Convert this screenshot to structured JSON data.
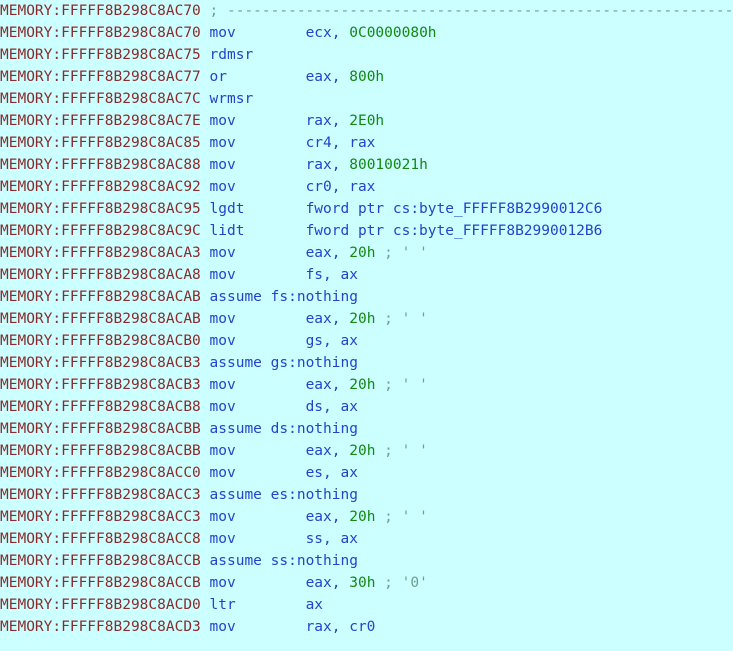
{
  "view": {
    "name": "IDA Pro disassembly listing",
    "segment": "MEMORY",
    "background_color": "#ccffff",
    "address_color": "#8b2b2b",
    "mnemonic_color": "#2244cc",
    "operand_color": "#2244cc",
    "number_color": "#118811",
    "comment_color": "#6f9f8f"
  },
  "lines": [
    {
      "address": "MEMORY:FFFFF8B298C8AC70",
      "kind": "comment",
      "comment": "; ---------------------------------------------------------------------------"
    },
    {
      "address": "MEMORY:FFFFF8B298C8AC70",
      "kind": "insn",
      "mnemonic": "mov",
      "operand_prefix": "ecx, ",
      "operand_number": "0C0000080h",
      "operand_suffix": "",
      "comment": ""
    },
    {
      "address": "MEMORY:FFFFF8B298C8AC75",
      "kind": "insn",
      "mnemonic": "rdmsr",
      "operand_prefix": "",
      "operand_number": "",
      "operand_suffix": "",
      "comment": ""
    },
    {
      "address": "MEMORY:FFFFF8B298C8AC77",
      "kind": "insn",
      "mnemonic": "or",
      "operand_prefix": "eax, ",
      "operand_number": "800h",
      "operand_suffix": "",
      "comment": ""
    },
    {
      "address": "MEMORY:FFFFF8B298C8AC7C",
      "kind": "insn",
      "mnemonic": "wrmsr",
      "operand_prefix": "",
      "operand_number": "",
      "operand_suffix": "",
      "comment": ""
    },
    {
      "address": "MEMORY:FFFFF8B298C8AC7E",
      "kind": "insn",
      "mnemonic": "mov",
      "operand_prefix": "rax, ",
      "operand_number": "2E0h",
      "operand_suffix": "",
      "comment": ""
    },
    {
      "address": "MEMORY:FFFFF8B298C8AC85",
      "kind": "insn",
      "mnemonic": "mov",
      "operand_prefix": "cr4, rax",
      "operand_number": "",
      "operand_suffix": "",
      "comment": ""
    },
    {
      "address": "MEMORY:FFFFF8B298C8AC88",
      "kind": "insn",
      "mnemonic": "mov",
      "operand_prefix": "rax, ",
      "operand_number": "80010021h",
      "operand_suffix": "",
      "comment": ""
    },
    {
      "address": "MEMORY:FFFFF8B298C8AC92",
      "kind": "insn",
      "mnemonic": "mov",
      "operand_prefix": "cr0, rax",
      "operand_number": "",
      "operand_suffix": "",
      "comment": ""
    },
    {
      "address": "MEMORY:FFFFF8B298C8AC95",
      "kind": "insn",
      "mnemonic": "lgdt",
      "operand_prefix": "fword ptr cs:byte_FFFFF8B2990012C6",
      "operand_number": "",
      "operand_suffix": "",
      "comment": ""
    },
    {
      "address": "MEMORY:FFFFF8B298C8AC9C",
      "kind": "insn",
      "mnemonic": "lidt",
      "operand_prefix": "fword ptr cs:byte_FFFFF8B2990012B6",
      "operand_number": "",
      "operand_suffix": "",
      "comment": ""
    },
    {
      "address": "MEMORY:FFFFF8B298C8ACA3",
      "kind": "insn",
      "mnemonic": "mov",
      "operand_prefix": "eax, ",
      "operand_number": "20h",
      "operand_suffix": "",
      "comment": "; ' '"
    },
    {
      "address": "MEMORY:FFFFF8B298C8ACA8",
      "kind": "insn",
      "mnemonic": "mov",
      "operand_prefix": "fs, ax",
      "operand_number": "",
      "operand_suffix": "",
      "comment": ""
    },
    {
      "address": "MEMORY:FFFFF8B298C8ACAB",
      "kind": "assume",
      "keyword": "assume",
      "text": "fs:nothing"
    },
    {
      "address": "MEMORY:FFFFF8B298C8ACAB",
      "kind": "insn",
      "mnemonic": "mov",
      "operand_prefix": "eax, ",
      "operand_number": "20h",
      "operand_suffix": "",
      "comment": "; ' '"
    },
    {
      "address": "MEMORY:FFFFF8B298C8ACB0",
      "kind": "insn",
      "mnemonic": "mov",
      "operand_prefix": "gs, ax",
      "operand_number": "",
      "operand_suffix": "",
      "comment": ""
    },
    {
      "address": "MEMORY:FFFFF8B298C8ACB3",
      "kind": "assume",
      "keyword": "assume",
      "text": "gs:nothing"
    },
    {
      "address": "MEMORY:FFFFF8B298C8ACB3",
      "kind": "insn",
      "mnemonic": "mov",
      "operand_prefix": "eax, ",
      "operand_number": "20h",
      "operand_suffix": "",
      "comment": "; ' '"
    },
    {
      "address": "MEMORY:FFFFF8B298C8ACB8",
      "kind": "insn",
      "mnemonic": "mov",
      "operand_prefix": "ds, ax",
      "operand_number": "",
      "operand_suffix": "",
      "comment": ""
    },
    {
      "address": "MEMORY:FFFFF8B298C8ACBB",
      "kind": "assume",
      "keyword": "assume",
      "text": "ds:nothing"
    },
    {
      "address": "MEMORY:FFFFF8B298C8ACBB",
      "kind": "insn",
      "mnemonic": "mov",
      "operand_prefix": "eax, ",
      "operand_number": "20h",
      "operand_suffix": "",
      "comment": "; ' '"
    },
    {
      "address": "MEMORY:FFFFF8B298C8ACC0",
      "kind": "insn",
      "mnemonic": "mov",
      "operand_prefix": "es, ax",
      "operand_number": "",
      "operand_suffix": "",
      "comment": ""
    },
    {
      "address": "MEMORY:FFFFF8B298C8ACC3",
      "kind": "assume",
      "keyword": "assume",
      "text": "es:nothing"
    },
    {
      "address": "MEMORY:FFFFF8B298C8ACC3",
      "kind": "insn",
      "mnemonic": "mov",
      "operand_prefix": "eax, ",
      "operand_number": "20h",
      "operand_suffix": "",
      "comment": "; ' '"
    },
    {
      "address": "MEMORY:FFFFF8B298C8ACC8",
      "kind": "insn",
      "mnemonic": "mov",
      "operand_prefix": "ss, ax",
      "operand_number": "",
      "operand_suffix": "",
      "comment": ""
    },
    {
      "address": "MEMORY:FFFFF8B298C8ACCB",
      "kind": "assume",
      "keyword": "assume",
      "text": "ss:nothing"
    },
    {
      "address": "MEMORY:FFFFF8B298C8ACCB",
      "kind": "insn",
      "mnemonic": "mov",
      "operand_prefix": "eax, ",
      "operand_number": "30h",
      "operand_suffix": "",
      "comment": "; '0'"
    },
    {
      "address": "MEMORY:FFFFF8B298C8ACD0",
      "kind": "insn",
      "mnemonic": "ltr",
      "operand_prefix": "ax",
      "operand_number": "",
      "operand_suffix": "",
      "comment": ""
    },
    {
      "address": "MEMORY:FFFFF8B298C8ACD3",
      "kind": "insn",
      "mnemonic": "mov",
      "operand_prefix": "rax, cr0",
      "operand_number": "",
      "operand_suffix": "",
      "comment": ""
    }
  ]
}
